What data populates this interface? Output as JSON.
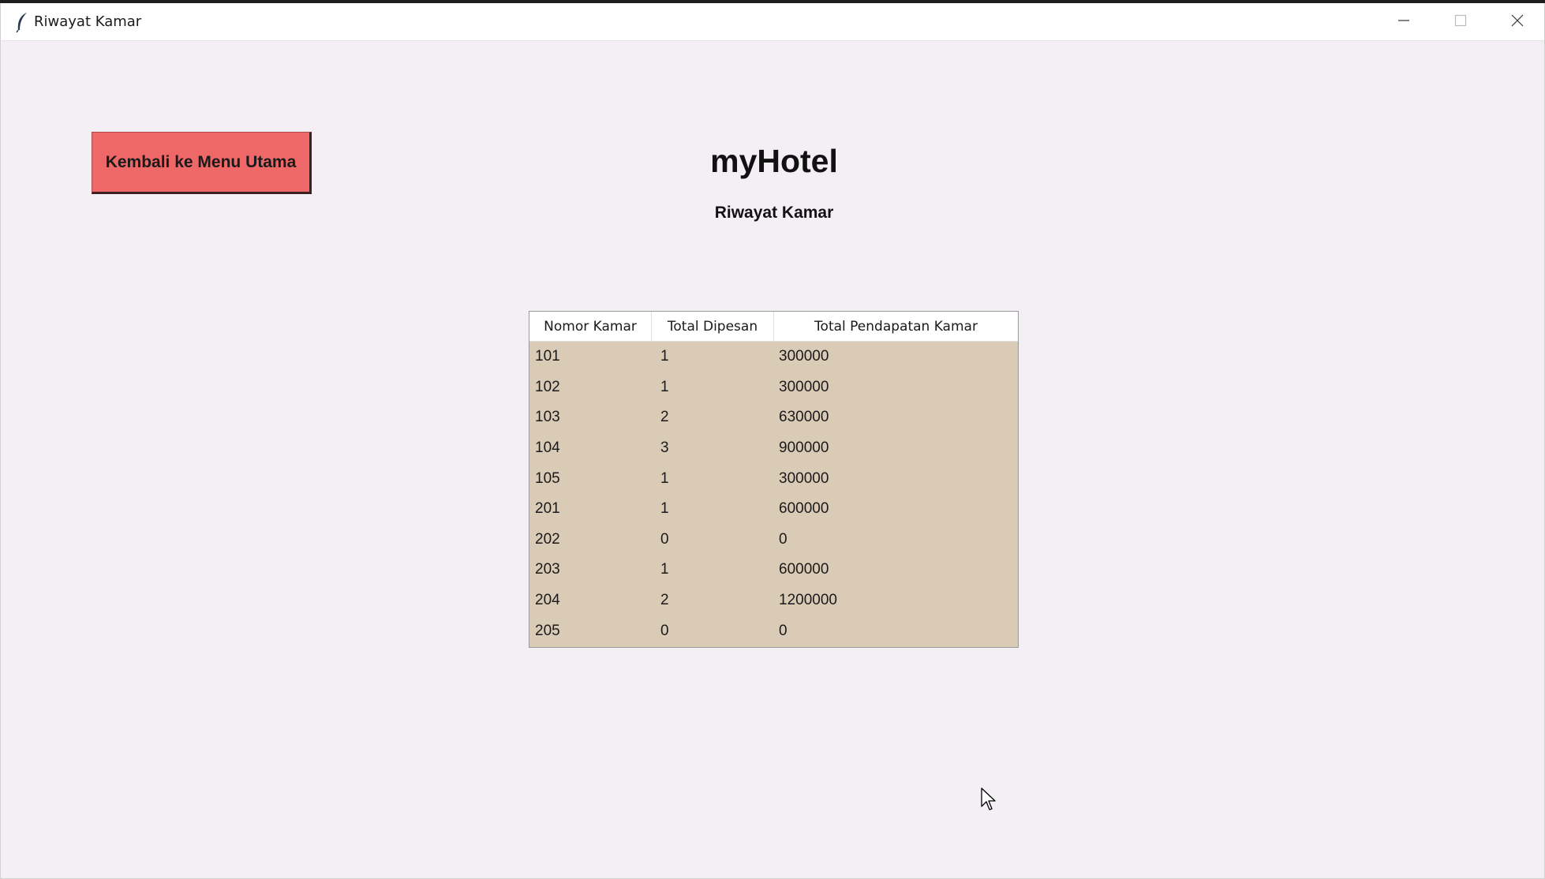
{
  "window": {
    "title": "Riwayat Kamar",
    "app_icon": "feather-icon",
    "controls": [
      "minimize-icon",
      "maximize-icon",
      "close-icon"
    ]
  },
  "main": {
    "back_button_label": "Kembali ke Menu Utama",
    "app_title": "myHotel",
    "subtitle": "Riwayat Kamar"
  },
  "table": {
    "columns": [
      "Nomor Kamar",
      "Total Dipesan",
      "Total Pendapatan Kamar"
    ],
    "rows": [
      [
        "101",
        "1",
        "300000"
      ],
      [
        "102",
        "1",
        "300000"
      ],
      [
        "103",
        "2",
        "630000"
      ],
      [
        "104",
        "3",
        "900000"
      ],
      [
        "105",
        "1",
        "300000"
      ],
      [
        "201",
        "1",
        "600000"
      ],
      [
        "202",
        "0",
        "0"
      ],
      [
        "203",
        "1",
        "600000"
      ],
      [
        "204",
        "2",
        "1200000"
      ],
      [
        "205",
        "0",
        "0"
      ]
    ]
  },
  "colors": {
    "window_bg": "#f4eff4",
    "button_bg": "#ed6867",
    "row_bg": "#dacbb7"
  }
}
